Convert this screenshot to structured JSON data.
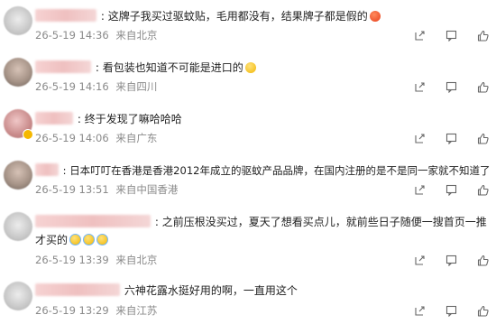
{
  "comments": [
    {
      "text": "这牌子我买过驱蚊贴，毛用都没有，结果牌子都是假的",
      "emoji": "angry-face",
      "date": "26-5-19 14:36",
      "location": "来自北京"
    },
    {
      "text": "看包装也知道不可能是进口的",
      "emoji": "grin-face",
      "date": "26-5-19 14:16",
      "location": "来自四川"
    },
    {
      "text": "终于发现了嘛哈哈哈",
      "date": "26-5-19 14:06",
      "location": "来自广东"
    },
    {
      "text": "日本叮叮在香港是香港2012年成立的驱蚊产品品牌，在国内注册的是不是同一家就不知道了",
      "date": "26-5-19 13:51",
      "location": "来自中国香港"
    },
    {
      "text": "之前压根没买过，夏天了想看买点儿，就前些日子随便一搜首页一推才买的",
      "emoji": "laugh-cry-face x3",
      "date": "26-5-19 13:39",
      "location": "来自北京"
    },
    {
      "text": "六神花露水挺好用的啊，一直用这个",
      "date": "26-5-19 13:29",
      "location": "来自江苏"
    }
  ],
  "icons": {
    "share": "share-icon",
    "comment": "comment-icon",
    "like": "like-icon"
  },
  "colors": {
    "text": "#222222",
    "meta": "#8a8a8a",
    "icon": "#666666",
    "badge": "#f5b800"
  }
}
